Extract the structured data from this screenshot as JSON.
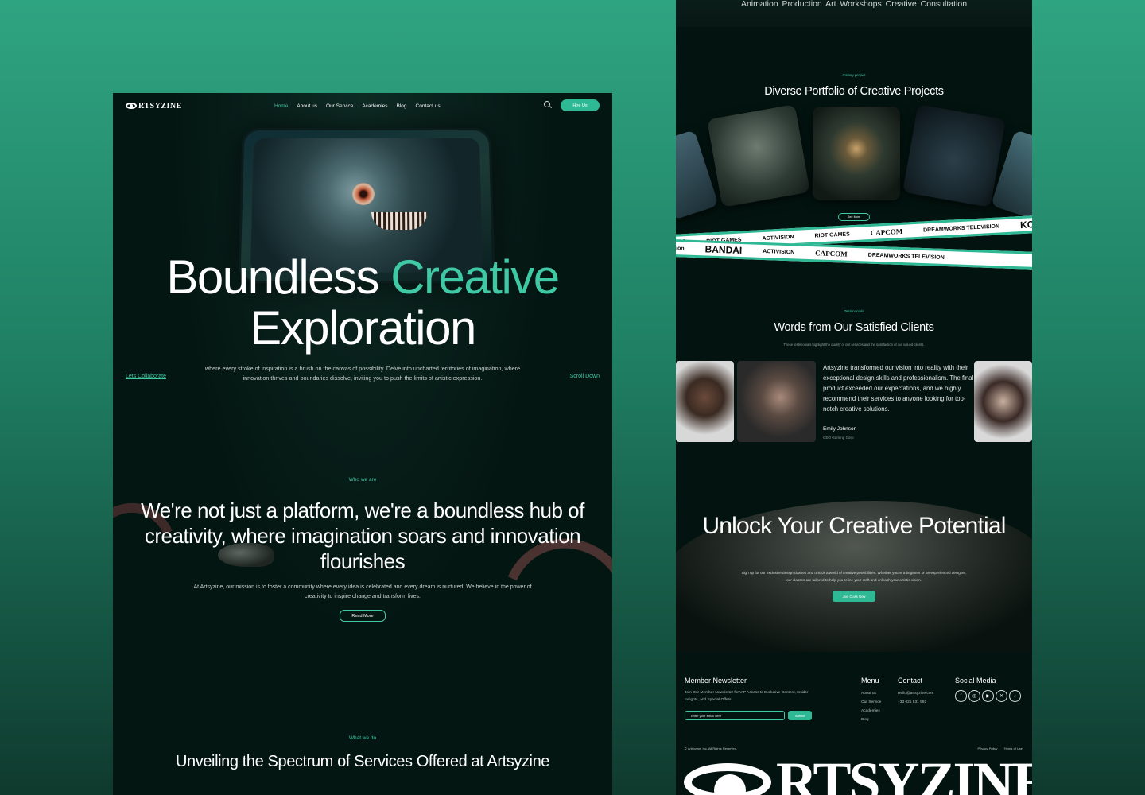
{
  "left": {
    "brand": "RTSYZINE",
    "nav": [
      "Home",
      "About us",
      "Our Service",
      "Academies",
      "Blog",
      "Contact us"
    ],
    "hire_label": "Hire Us",
    "hero": {
      "title_line1_a": "Boundless ",
      "title_line1_b": "Creative",
      "title_line2": "Exploration",
      "subtitle": "where every stroke of inspiration is a brush on the canvas of possibility. Delve into uncharted territories of imagination, where innovation thrives and boundaries dissolve, inviting you to push the limits of artistic expression.",
      "collab_link": "Lets Collaborate",
      "scroll_link": "Scroll Down"
    },
    "who": {
      "label": "Who we are",
      "title": "We're not just a platform, we're a boundless hub of creativity, where imagination soars and innovation flourishes",
      "text": "At Artsyzine, our mission is to foster a community where every idea is celebrated and every dream is nurtured. We believe in the power of creativity to inspire change and transform lives.",
      "button": "Read More"
    },
    "what": {
      "label": "What we do",
      "title": "Unveiling the Spectrum of Services Offered at Artsyzine"
    }
  },
  "right": {
    "services_row": "Animation Production  Art Workshops  Creative Consultation",
    "gallery": {
      "label": "Gallery project",
      "title": "Diverse Portfolio of Creative Projects",
      "button": "See More"
    },
    "brands_row1": [
      "AI",
      "RIOT GAMES",
      "ACTIVISION",
      "RIOT GAMES",
      "CAPCOM",
      "DREAMWORKS TELEVISION",
      "KO"
    ],
    "brands_row2": [
      "ion",
      "BANDAI",
      "ACTIVISION",
      "CAPCOM",
      "DREAMWORKS TELEVISION"
    ],
    "testimonials": {
      "label": "Testimonials",
      "title": "Words from Our Satisfied Clients",
      "subtitle": "These testimonials highlight the quality of our services and the satisfaction of our valued clients.",
      "quote": "Artsyzine transformed our vision into reality with their exceptional design skills and professionalism. The final product exceeded our expectations, and we highly recommend their services to anyone looking for top-notch creative solutions.",
      "name": "Emily Johnson",
      "role": "CEO Gaming Corp"
    },
    "cta": {
      "title": "Unlock Your Creative Potential",
      "subtitle": "Sign up for our exclusive design classes and unlock a world of creative possibilities. Whether you're a beginner or an experienced designer, our classes are tailored to help you refine your craft and unleash your artistic vision.",
      "button": "Join Class Now"
    },
    "footer": {
      "newsletter_title": "Member Newsletter",
      "newsletter_text": "Join Our Member Newsletter for VIP Access to Exclusive Content, Insider Insights, and Special Offers",
      "email_placeholder": "Enter your email here",
      "submit": "Submit",
      "menu_title": "Menu",
      "menu_items": [
        "About us",
        "Our Service",
        "Academies",
        "Blog"
      ],
      "contact_title": "Contact",
      "contact_email": "Hello@artsyzine.com",
      "contact_phone": "+33 021 531 992",
      "social_title": "Social Media",
      "socials": [
        "facebook-icon",
        "instagram-icon",
        "youtube-icon",
        "x-icon",
        "tiktok-icon"
      ],
      "copyright": "© Artsyzine, Inc. All Rights Reserved.",
      "privacy": "Privacy Policy",
      "terms": "Terms of Use",
      "big_brand": "RTSYZINE"
    }
  }
}
